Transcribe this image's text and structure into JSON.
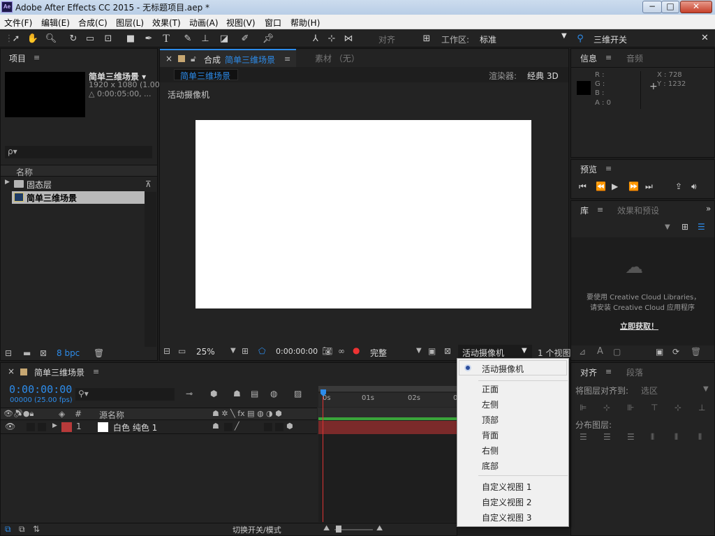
{
  "titlebar": {
    "app_logo": "Ae",
    "title": "Adobe After Effects CC 2015 - 无标题项目.aep *",
    "min": "−",
    "max": "□",
    "close": "✕"
  },
  "menu": [
    "文件(F)",
    "编辑(E)",
    "合成(C)",
    "图层(L)",
    "效果(T)",
    "动画(A)",
    "视图(V)",
    "窗口",
    "帮助(H)"
  ],
  "toolbar": {
    "snap_label": "对齐",
    "workspace_label": "工作区:",
    "workspace_value": "标准",
    "search_value": "三维开关"
  },
  "project": {
    "panel_title": "项目",
    "comp_name": "简单三维场景 ▾",
    "comp_size": "1920 x 1080 (1.00)",
    "comp_duration": "△ 0:00:05:00, ...",
    "search_placeholder": "ρ▾",
    "col_name": "名称",
    "items": [
      {
        "name": "固态层",
        "type": "folder"
      },
      {
        "name": "简单三维场景",
        "type": "comp"
      }
    ],
    "bpc": "8 bpc"
  },
  "comp_panel": {
    "tab_label": "合成",
    "tab_name": "简单三维场景",
    "footage_tab": "素材 （无）",
    "active_chip": "简单三维场景",
    "renderer_label": "渲染器:",
    "renderer_value": "经典 3D",
    "camera_label": "活动摄像机",
    "zoom": "25%",
    "timecode": "0:00:00:00",
    "resolution": "完整",
    "view": "活动摄像机",
    "views_count": "1 个视图"
  },
  "info": {
    "tab": "信息",
    "tab2": "音频",
    "r": "R :",
    "g": "G :",
    "b": "B :",
    "a": "A : 0",
    "x": "X : 728",
    "y": "Y : 1232"
  },
  "preview": {
    "tab": "预览"
  },
  "library": {
    "tab": "库",
    "tab2": "效果和预设",
    "msg1": "要使用 Creative Cloud Libraries，",
    "msg2": "请安装 Creative Cloud 应用程序",
    "link": "立即获取！"
  },
  "align": {
    "tab": "对齐",
    "tab2": "段落",
    "align_to_label": "将图层对齐到:",
    "align_to_value": "选区",
    "distribute_label": "分布图层:"
  },
  "timeline": {
    "tab_name": "简单三维场景",
    "timecode": "0:00:00:00",
    "fps": "00000 (25.00 fps)",
    "col_hash": "#",
    "col_source": "源名称",
    "layer_num": "1",
    "layer_name": "白色 纯色 1",
    "ruler": [
      "0s",
      "01s",
      "02s",
      "0"
    ],
    "footer": "切换开关/模式"
  },
  "dropdown": {
    "selected": "活动摄像机",
    "group1": [
      "正面",
      "左侧",
      "顶部",
      "背面",
      "右侧",
      "底部"
    ],
    "group2": [
      "自定义视图 1",
      "自定义视图 2",
      "自定义视图 3"
    ]
  },
  "colors": {
    "accent": "#2d8ceb",
    "layer_label": "#b83a3a",
    "track_bar": "#7b2a2a",
    "green_bar": "#3aa53a"
  }
}
